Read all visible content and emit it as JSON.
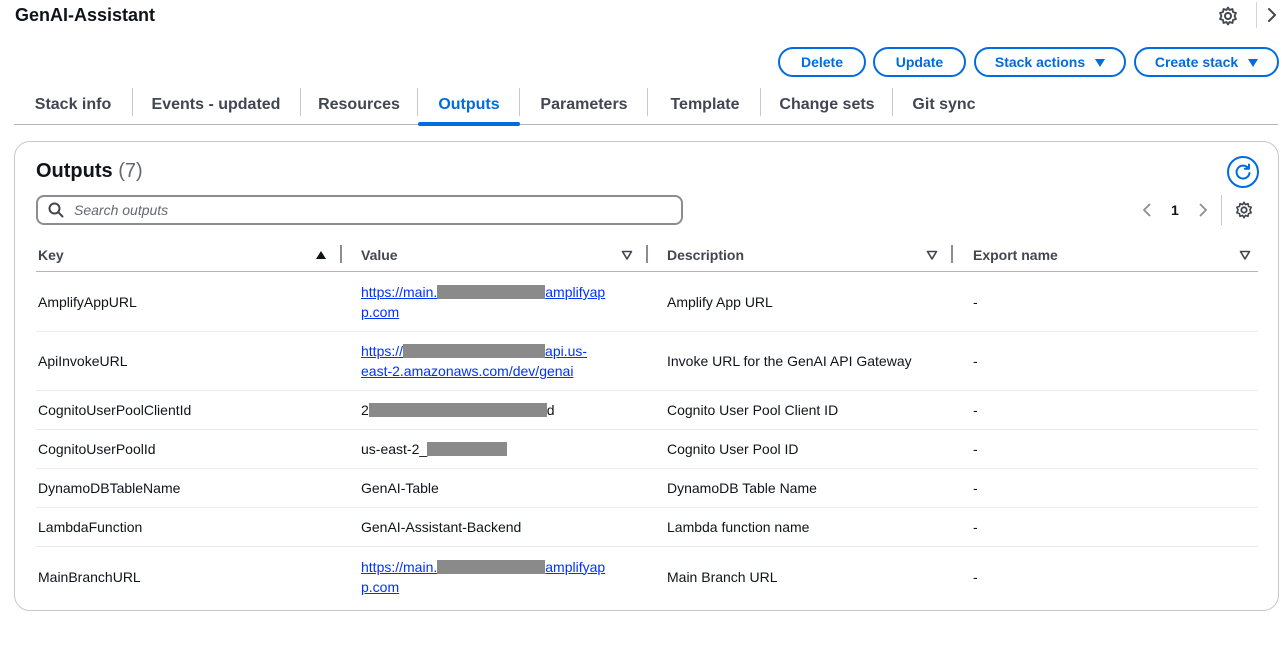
{
  "page": {
    "title": "GenAI-Assistant"
  },
  "actions": {
    "delete_label": "Delete",
    "update_label": "Update",
    "stack_actions_label": "Stack actions",
    "create_stack_label": "Create stack"
  },
  "tabs": [
    {
      "label": "Stack info",
      "active": false
    },
    {
      "label": "Events - updated",
      "active": false
    },
    {
      "label": "Resources",
      "active": false
    },
    {
      "label": "Outputs",
      "active": true
    },
    {
      "label": "Parameters",
      "active": false
    },
    {
      "label": "Template",
      "active": false
    },
    {
      "label": "Change sets",
      "active": false
    },
    {
      "label": "Git sync",
      "active": false
    }
  ],
  "outputs": {
    "title": "Outputs",
    "count": "(7)",
    "search_placeholder": "Search outputs",
    "page_number": "1",
    "columns": {
      "key": "Key",
      "value": "Value",
      "description": "Description",
      "export_name": "Export name"
    },
    "rows": [
      {
        "key": "AmplifyAppURL",
        "value_prefix": "https://main.",
        "value_suffix": "amplifyap",
        "value_line2": "p.com",
        "description": "Amplify App URL",
        "export_name": "-"
      },
      {
        "key": "ApiInvokeURL",
        "value_prefix": "https://",
        "value_suffix": "api.us-",
        "value_line2": "east-2.amazonaws.com/dev/genai",
        "description": "Invoke URL for the GenAI API Gateway",
        "export_name": "-"
      },
      {
        "key": "CognitoUserPoolClientId",
        "value_prefix": "2",
        "value_suffix": "d",
        "description": "Cognito User Pool Client ID",
        "export_name": "-"
      },
      {
        "key": "CognitoUserPoolId",
        "value_prefix": "us-east-2_",
        "value_suffix": "",
        "description": "Cognito User Pool ID",
        "export_name": "-"
      },
      {
        "key": "DynamoDBTableName",
        "value": "GenAI-Table",
        "description": "DynamoDB Table Name",
        "export_name": "-"
      },
      {
        "key": "LambdaFunction",
        "value": "GenAI-Assistant-Backend",
        "description": "Lambda function name",
        "export_name": "-"
      },
      {
        "key": "MainBranchURL",
        "value_prefix": "https://main.",
        "value_suffix": "amplifyap",
        "value_line2": "p.com",
        "description": "Main Branch URL",
        "export_name": "-"
      }
    ]
  },
  "colors": {
    "accent": "#006ce0",
    "link": "#0032ff",
    "redaction": "#8a8a8a"
  },
  "icons": {
    "settings": "gear-icon",
    "expand": "chevron-right-icon",
    "refresh": "refresh-icon",
    "search": "search-icon",
    "prev": "chevron-left-icon",
    "next": "chevron-right-icon",
    "sort_asc": "sort-ascending-icon",
    "sort": "sort-descending-icon",
    "dropdown": "caret-down-icon"
  }
}
